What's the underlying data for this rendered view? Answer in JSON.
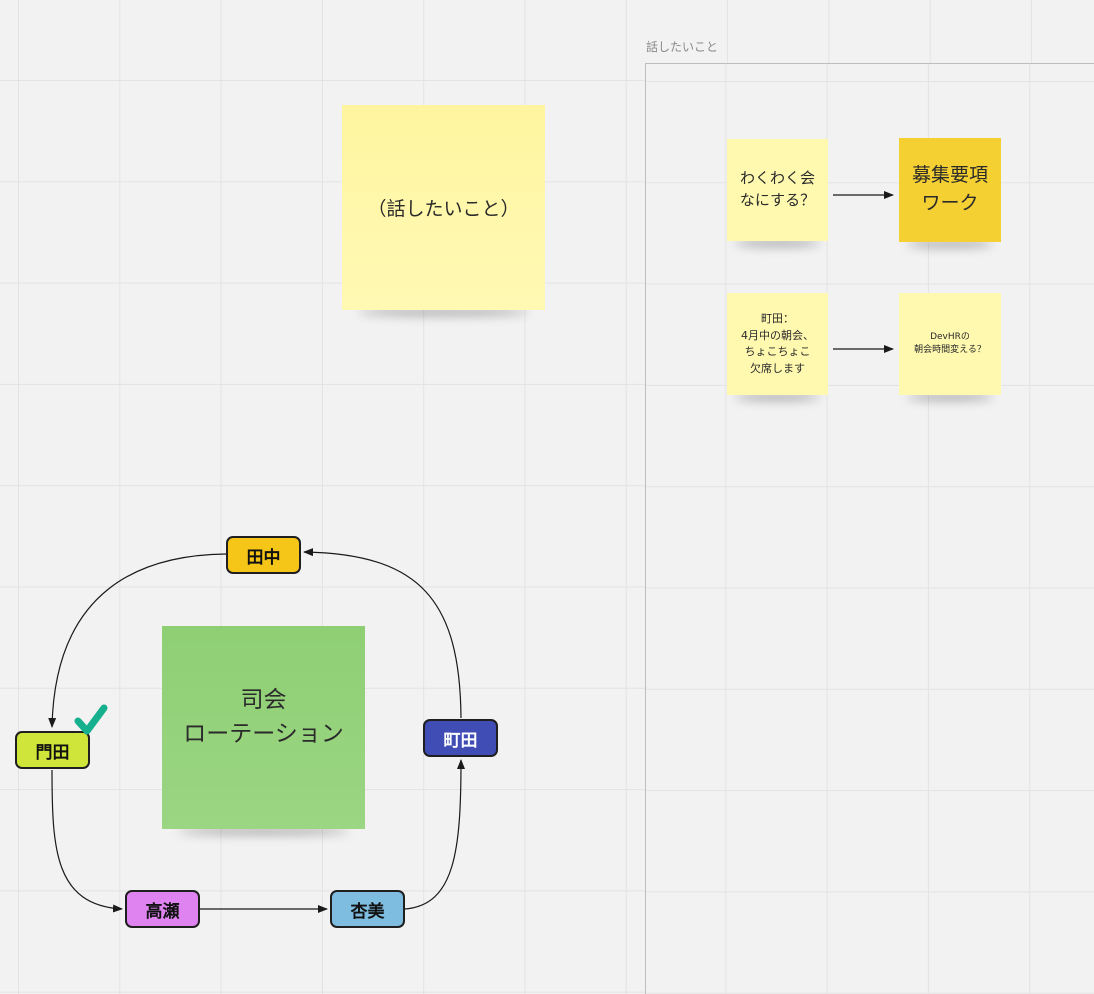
{
  "frame": {
    "label": "話したいこと"
  },
  "stickies": {
    "topic": "（話したいこと）",
    "wakuwaku": "わくわく会\nなにする？",
    "boshu": "募集要項\nワーク",
    "machida_note": "町田：\n4月中の朝会、\nちょこちょこ\n欠席します",
    "devhr": "DevHRの\n朝会時間変える？",
    "rotation": "司会\nローテーション"
  },
  "nodes": {
    "tanaka": "田中",
    "kadota": "門田",
    "machida": "町田",
    "takase": "高瀬",
    "anzumi": "杏美"
  },
  "colors": {
    "sticky_yellow": "#fff9b0",
    "sticky_gold": "#f4d033",
    "sticky_green": "#94d37a",
    "node_tanaka": "#f5c518",
    "node_kadota": "#cfe53a",
    "node_machida": "#3f4db5",
    "node_takase": "#de83f0",
    "node_anzumi": "#7ebde0",
    "check": "#16b08f"
  }
}
